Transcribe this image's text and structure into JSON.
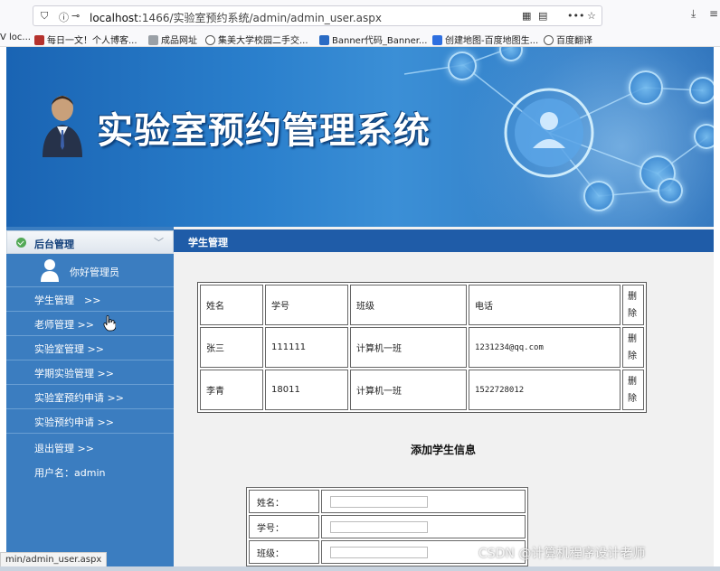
{
  "browser": {
    "url_host": "localhost",
    "url_rest": ":1466/实验室预约系统/admin/admin_user.aspx",
    "bookmarks": [
      "V loc...",
      "每日一文！个人博客...",
      "成品网址",
      "集美大学校园二手交...",
      "Banner代码_Banner...",
      "创建地图-百度地图生...",
      "百度翻译"
    ],
    "status_url": "min/admin_user.aspx"
  },
  "banner": {
    "title": "实验室预约管理系统"
  },
  "sidebar": {
    "header": "后台管理",
    "greeting": "你好管理员",
    "items": [
      "学生管理　>>",
      "老师管理 >>",
      "实验室管理 >>",
      "学期实验管理 >>",
      "实验室预约申请 >>",
      "实验预约申请 >>",
      "退出管理 >>"
    ],
    "username": "用户名：admin"
  },
  "main": {
    "header": "学生管理",
    "table": {
      "headers": [
        "姓名",
        "学号",
        "班级",
        "电话",
        "删除"
      ],
      "rows": [
        {
          "name": "张三",
          "id": "111111",
          "class": "计算机一班",
          "phone": "1231234@qq.com",
          "action": "删除"
        },
        {
          "name": "李青",
          "id": "18011",
          "class": "计算机一班",
          "phone": "1522728012",
          "action": "删除"
        }
      ]
    },
    "add_title": "添加学生信息",
    "form_labels": [
      "姓名：",
      "学号：",
      "班级："
    ]
  },
  "watermark": "CSDN @计算机程序设计老师",
  "colors": {
    "sidebar": "#3b7dc0",
    "header": "#1f5ca8",
    "delete": "#dd2222"
  }
}
